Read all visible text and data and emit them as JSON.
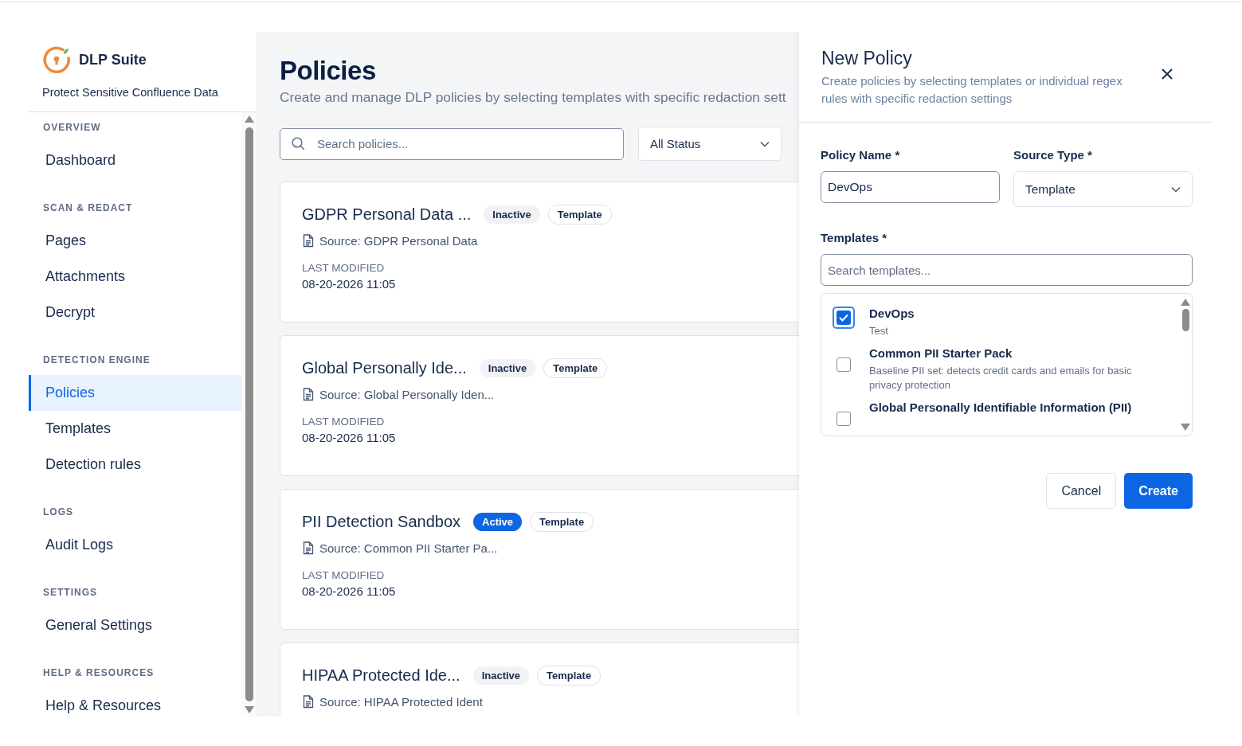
{
  "app": {
    "name": "DLP Suite",
    "tagline": "Protect Sensitive Confluence Data"
  },
  "sidebar": {
    "sections": [
      {
        "heading": "OVERVIEW",
        "items": [
          {
            "label": "Dashboard",
            "selected": false
          }
        ]
      },
      {
        "heading": "SCAN & REDACT",
        "items": [
          {
            "label": "Pages",
            "selected": false
          },
          {
            "label": "Attachments",
            "selected": false
          },
          {
            "label": "Decrypt",
            "selected": false
          }
        ]
      },
      {
        "heading": "DETECTION ENGINE",
        "items": [
          {
            "label": "Policies",
            "selected": true
          },
          {
            "label": "Templates",
            "selected": false
          },
          {
            "label": "Detection rules",
            "selected": false
          }
        ]
      },
      {
        "heading": "LOGS",
        "items": [
          {
            "label": "Audit Logs",
            "selected": false
          }
        ]
      },
      {
        "heading": "SETTINGS",
        "items": [
          {
            "label": "General Settings",
            "selected": false
          }
        ]
      },
      {
        "heading": "HELP & RESOURCES",
        "items": [
          {
            "label": "Help & Resources",
            "selected": false
          }
        ]
      }
    ]
  },
  "page": {
    "title": "Policies",
    "subtitle": "Create and manage DLP policies by selecting templates with specific redaction sett"
  },
  "filters": {
    "search": {
      "placeholder": "Search policies..."
    },
    "status": {
      "value": "All Status"
    }
  },
  "policies": [
    {
      "name": "GDPR Personal Data ...",
      "status": {
        "label": "Inactive",
        "active": false
      },
      "type": "Template",
      "source": "Source: GDPR Personal Data",
      "modified_label": "LAST MODIFIED",
      "modified": "08-20-2026 11:05"
    },
    {
      "name": "Global Personally Ide...",
      "status": {
        "label": "Inactive",
        "active": false
      },
      "type": "Template",
      "source": "Source: Global Personally Iden...",
      "modified_label": "LAST MODIFIED",
      "modified": "08-20-2026 11:05"
    },
    {
      "name": "PII Detection Sandbox",
      "status": {
        "label": "Active",
        "active": true
      },
      "type": "Template",
      "source": "Source: Common PII Starter Pa...",
      "modified_label": "LAST MODIFIED",
      "modified": "08-20-2026 11:05"
    },
    {
      "name": "HIPAA Protected Ide...",
      "status": {
        "label": "Inactive",
        "active": false
      },
      "type": "Template",
      "source": "Source: HIPAA Protected Ident"
    }
  ],
  "panel": {
    "title": "New Policy",
    "description": "Create policies by selecting templates or individual regex rules with specific redaction settings",
    "policy_name": {
      "label": "Policy Name *",
      "value": "DevOps"
    },
    "source_type": {
      "label": "Source Type *",
      "value": "Template"
    },
    "templates": {
      "label": "Templates *",
      "placeholder": "Search templates...",
      "items": [
        {
          "name": "DevOps",
          "description": "Test",
          "checked": true
        },
        {
          "name": "Common PII Starter Pack",
          "description": "Baseline PII set: detects credit cards and emails for basic privacy protection",
          "checked": false
        },
        {
          "name": "Global Personally Identifiable Information (PII)",
          "checked": false
        }
      ]
    },
    "buttons": {
      "cancel": "Cancel",
      "create": "Create"
    }
  }
}
